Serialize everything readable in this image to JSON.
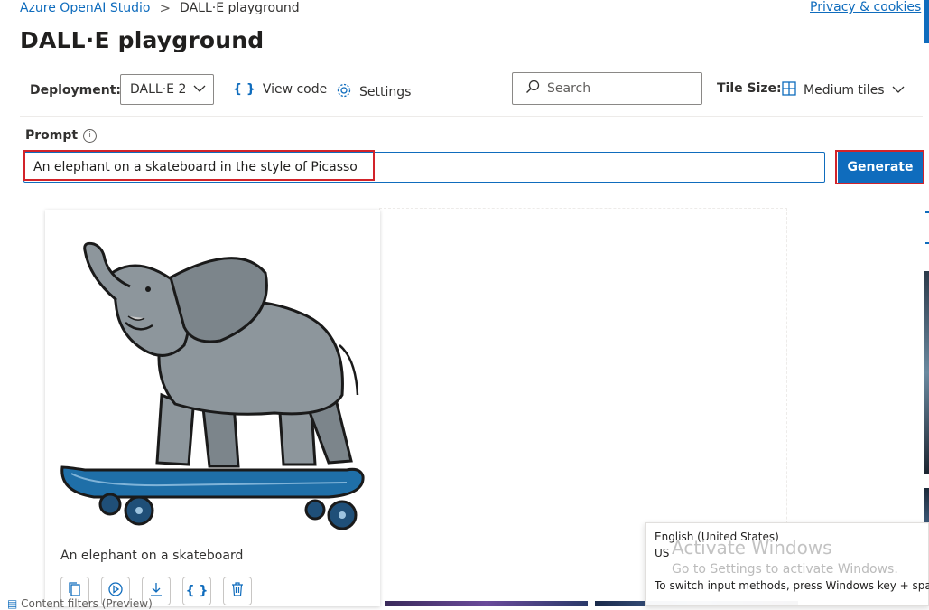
{
  "breadcrumb": {
    "root": "Azure OpenAI Studio",
    "separator": ">",
    "current": "DALL·E playground"
  },
  "privacy_link": "Privacy & cookies",
  "page_title": "DALL·E playground",
  "toolbar": {
    "deployment_label": "Deployment:",
    "deployment_value": "DALL·E 2",
    "view_code_label": "View code",
    "settings_label": "Settings",
    "search_placeholder": "Search",
    "tile_size_label": "Tile Size:",
    "tile_size_value": "Medium tiles"
  },
  "prompt": {
    "label": "Prompt",
    "info_glyph": "i",
    "value": "An elephant on a skateboard in the style of Picasso",
    "generate_label": "Generate"
  },
  "card": {
    "caption": "An elephant on a skateboard",
    "actions": [
      "copy-icon",
      "regenerate-icon",
      "download-icon",
      "code-icon",
      "delete-icon"
    ]
  },
  "footer_text": "Content filters (Preview)",
  "language_popup": {
    "line1": "English (United States)",
    "line2": "US",
    "line3": "To switch input methods, press Windows key + space."
  },
  "watermark": {
    "title": "Activate Windows",
    "subtitle": "Go to Settings to activate Windows."
  },
  "colors": {
    "accent": "#0f6cbd",
    "highlight": "#d2232a",
    "text": "#323130"
  }
}
